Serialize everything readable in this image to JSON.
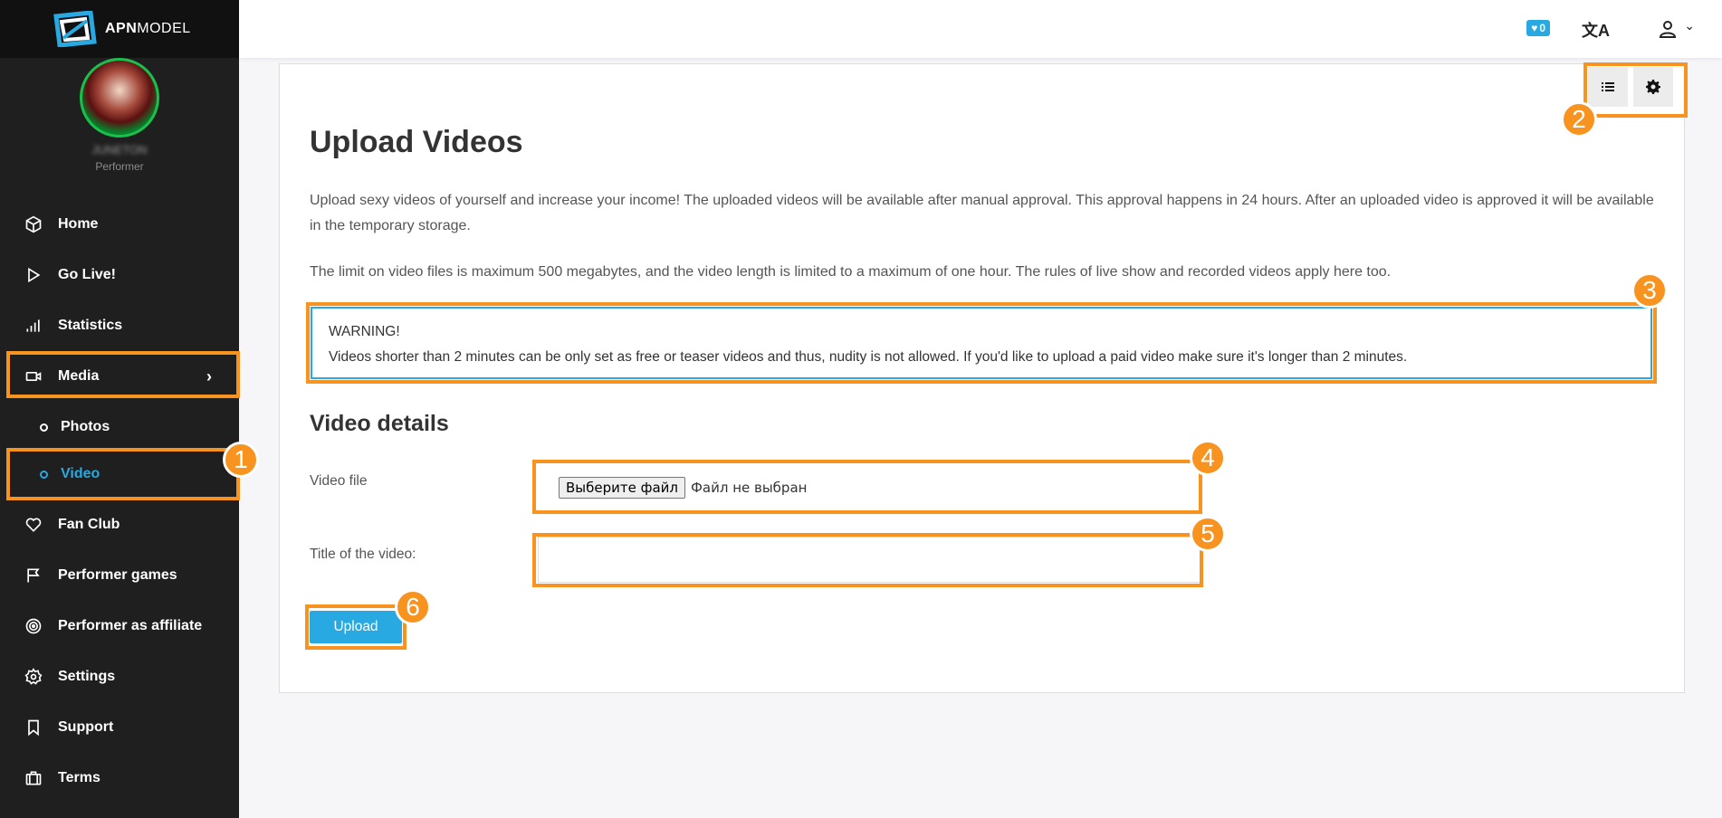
{
  "brand": {
    "name_bold": "APN",
    "name_rest": "MODEL"
  },
  "profile": {
    "name": "JUNETON",
    "role": "Performer"
  },
  "nav": {
    "home": "Home",
    "golive": "Go Live!",
    "statistics": "Statistics",
    "media": "Media",
    "photos": "Photos",
    "video": "Video",
    "fanclub": "Fan Club",
    "games": "Performer games",
    "affiliate": "Performer as affiliate",
    "settings": "Settings",
    "support": "Support",
    "terms": "Terms"
  },
  "topbar": {
    "favorites_count": "0",
    "language_icon": "translate-icon",
    "user_icon": "user-icon"
  },
  "page": {
    "title": "Upload Videos",
    "intro": "Upload sexy videos of yourself and increase your income! The uploaded videos will be available after manual approval. This approval happens in 24 hours. After an uploaded video is approved it will be available in the temporary storage.",
    "limit": "The limit on video files is maximum 500 megabytes, and the video length is limited to a maximum of one hour. The rules of live show and recorded videos apply here too.",
    "warning_title": "WARNING!",
    "warning_text": "Videos shorter than 2 minutes can be only set as free or teaser videos and thus, nudity is not allowed. If you'd like to upload a paid video make sure it's longer than 2 minutes."
  },
  "form": {
    "section_title": "Video details",
    "file_label": "Video file",
    "file_button": "Выберите файл",
    "file_status": "Файл не выбран",
    "title_label": "Title of the video:",
    "title_value": "",
    "upload_label": "Upload"
  },
  "annotations": [
    "1",
    "2",
    "3",
    "4",
    "5",
    "6"
  ],
  "colors": {
    "accent": "#29a9e1",
    "annotation": "#f7931e",
    "sidebar": "#1f1f1f"
  }
}
